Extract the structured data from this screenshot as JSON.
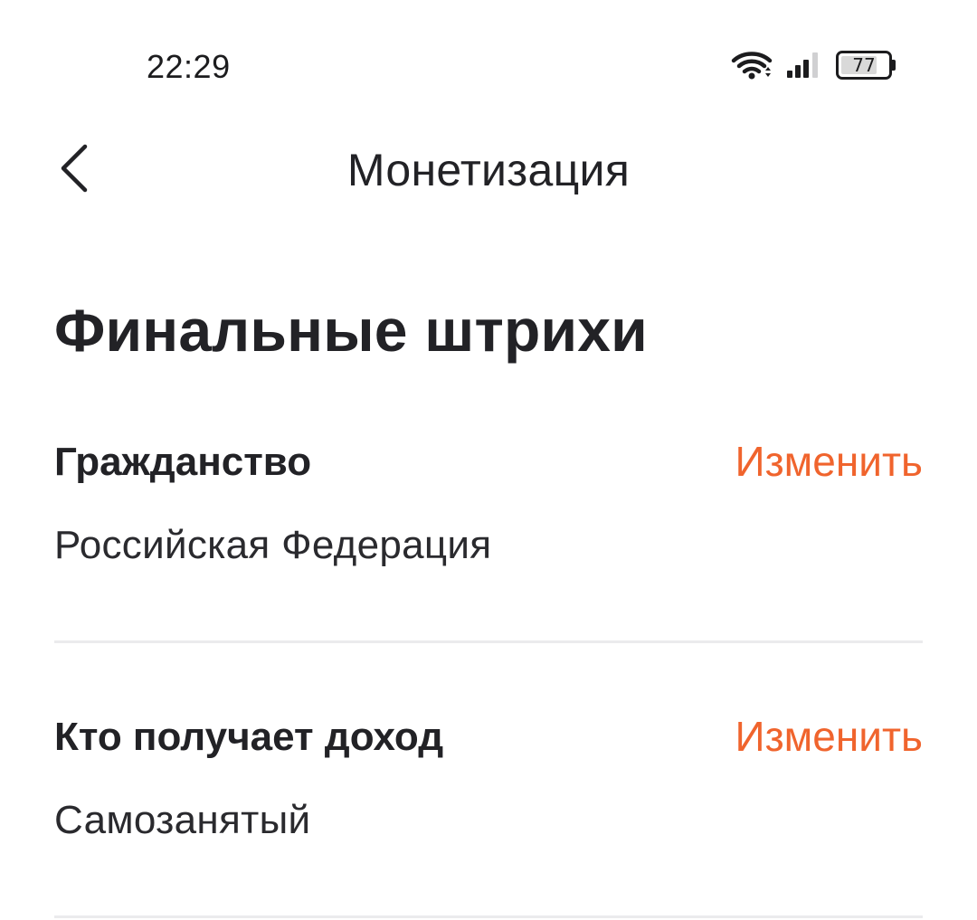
{
  "status_bar": {
    "time": "22:29",
    "battery_level": "77",
    "battery_fraction": 0.77,
    "icons": [
      "wifi-icon",
      "signal-icon",
      "battery-icon"
    ]
  },
  "header": {
    "title": "Монетизация",
    "back_icon": "chevron-left-icon"
  },
  "page": {
    "title": "Финальные штрихи"
  },
  "sections": [
    {
      "label": "Гражданство",
      "action": "Изменить",
      "value": "Российская Федерация"
    },
    {
      "label": "Кто получает доход",
      "action": "Изменить",
      "value": "Самозанятый"
    }
  ],
  "colors": {
    "accent": "#f0642d",
    "text": "#222226",
    "divider": "#ebebed",
    "background": "#ffffff"
  }
}
